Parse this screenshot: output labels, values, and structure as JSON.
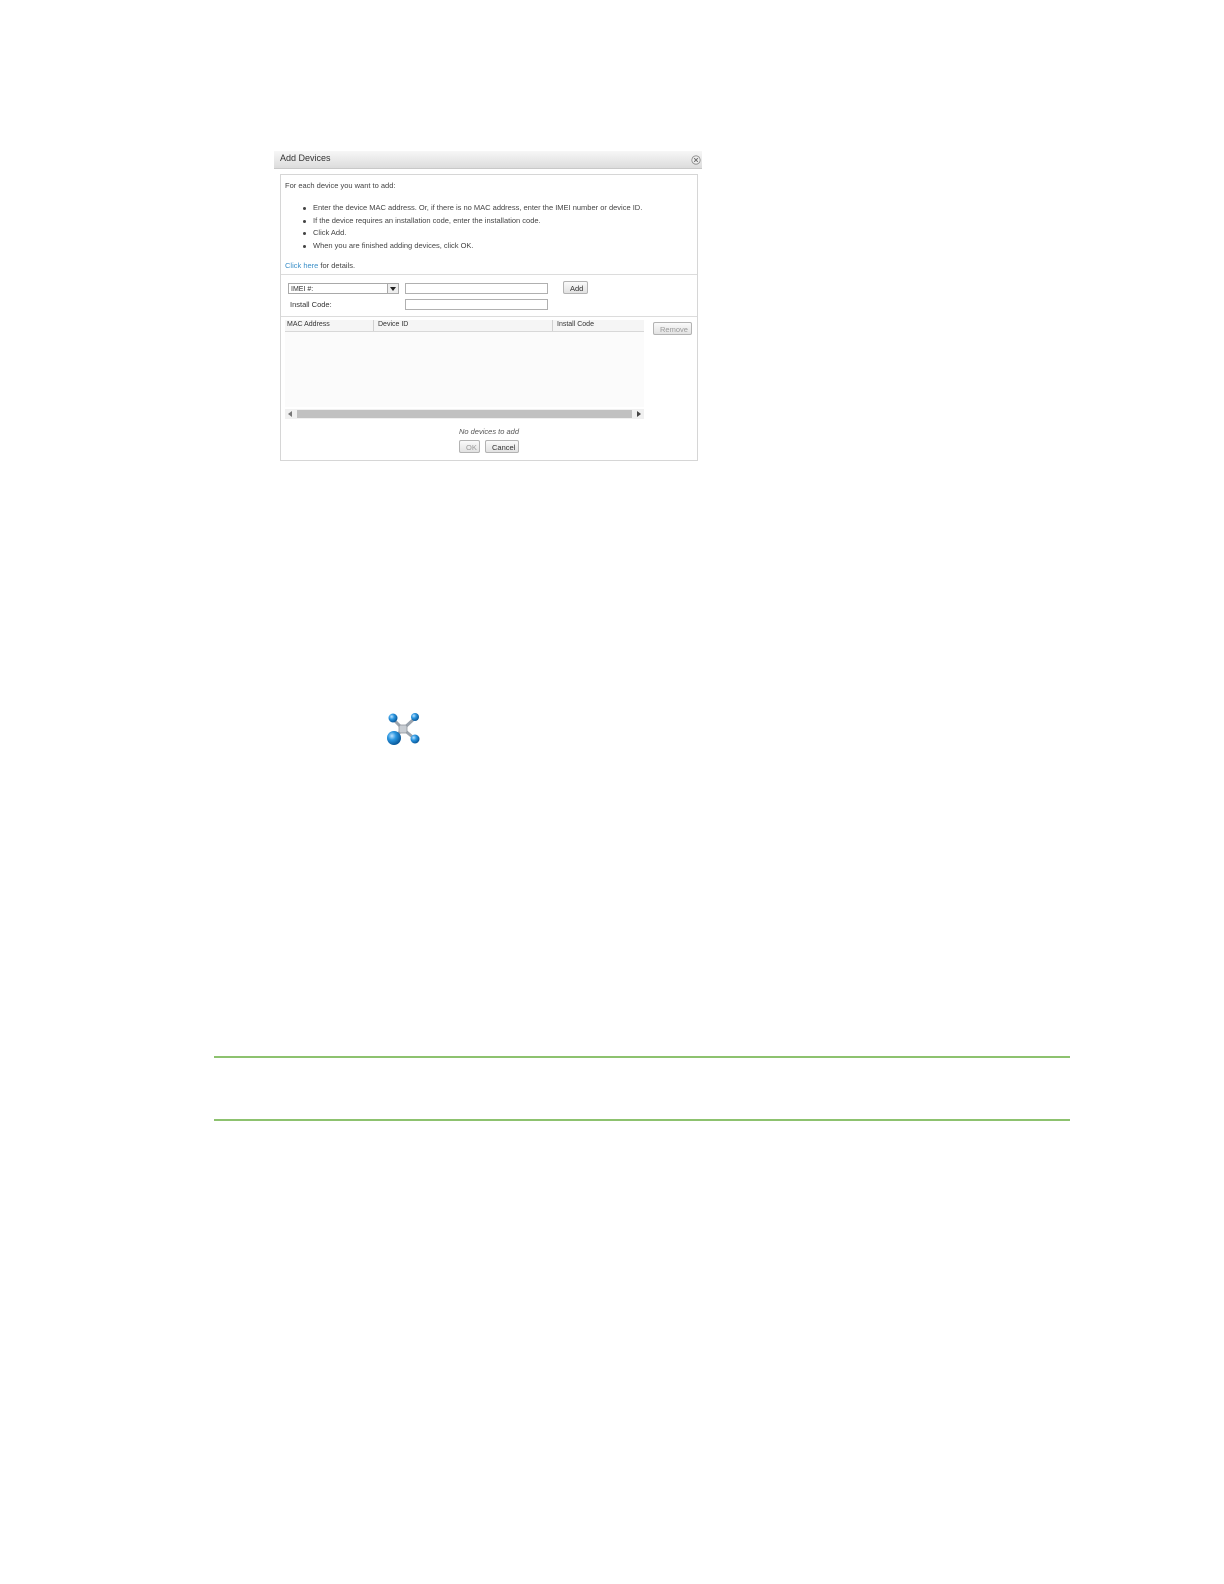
{
  "dialog": {
    "title": "Add Devices",
    "intro": "For each device you want to add:",
    "steps": [
      "Enter the device MAC address. Or, if there is no MAC address, enter the IMEI number or device ID.",
      "If the device requires an installation code, enter the installation code.",
      "Click Add.",
      "When you are finished adding devices, click OK."
    ],
    "details_link": "Click here",
    "details_suffix": " for details.",
    "id_type_select": "IMEI #:",
    "id_input_value": "",
    "install_code_label": "Install Code:",
    "install_code_value": "",
    "add_label": "Add",
    "remove_label": "Remove",
    "columns": [
      "MAC Address",
      "Device ID",
      "Install Code"
    ],
    "empty_message": "No devices to add",
    "ok_label": "OK",
    "cancel_label": "Cancel"
  },
  "icons": {
    "dialog_close": "close-icon",
    "network": "network-icon"
  },
  "colors": {
    "link": "#3a8fc8",
    "rule": "#8dc26f",
    "icon_blue": "#1e8bd6"
  }
}
